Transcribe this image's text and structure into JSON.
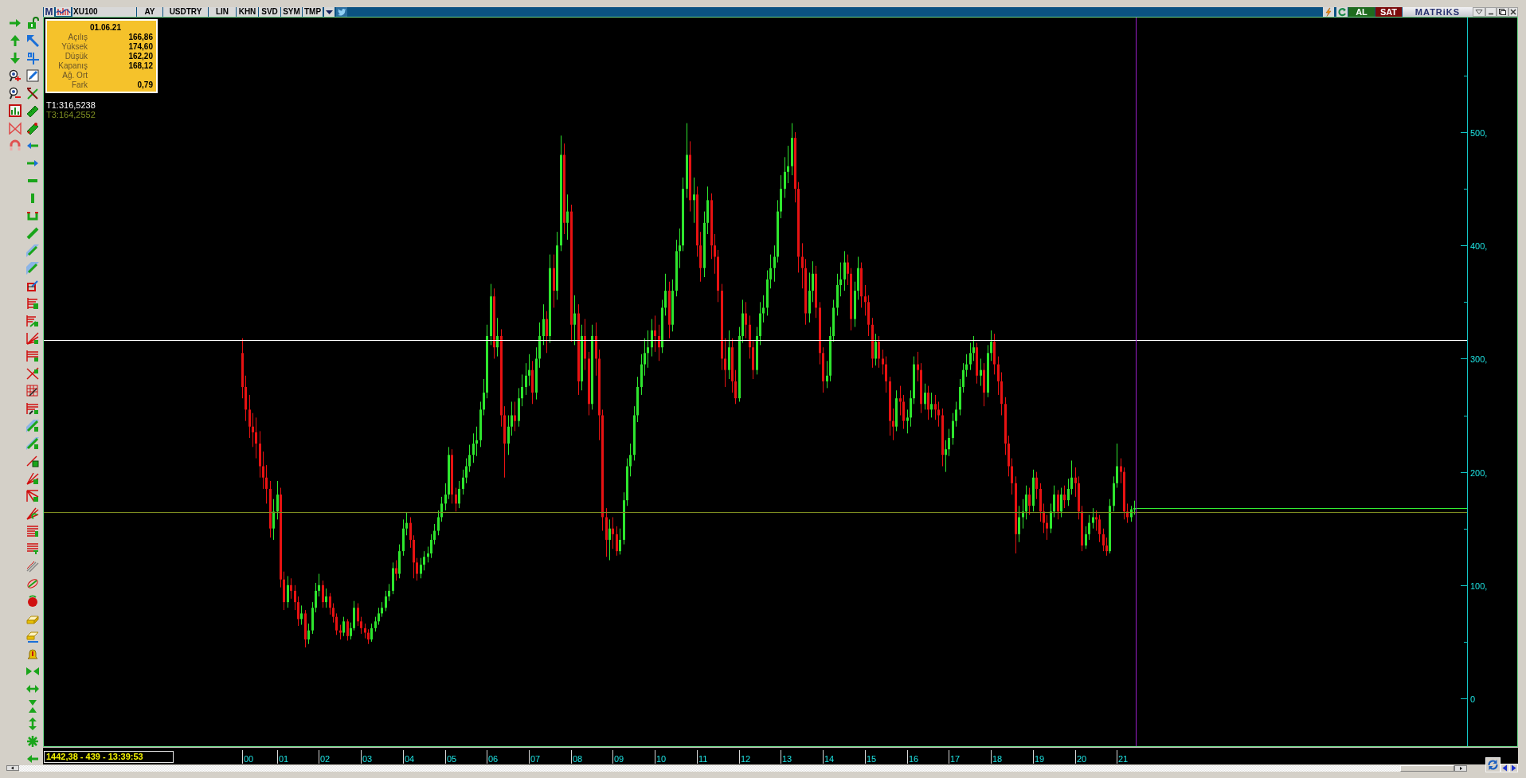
{
  "header": {
    "badge": "M",
    "symbol": "XU100",
    "buttons": [
      "AY",
      "USDTRY",
      "LIN",
      "KHN",
      "SVD",
      "SYM",
      "TMP"
    ],
    "trade_buttons": [
      {
        "label": "AL",
        "color": "#1e6b1e"
      },
      {
        "label": "SAT",
        "color": "#7c0b0b"
      }
    ],
    "logo": "MATRiKS"
  },
  "chart": {
    "info_box": {
      "date": "01.06.21",
      "rows": [
        {
          "label": "Açılış",
          "value": "166,86"
        },
        {
          "label": "Yüksek",
          "value": "174,60"
        },
        {
          "label": "Düşük",
          "value": "162,20"
        },
        {
          "label": "Kapanış",
          "value": "168,12"
        },
        {
          "label": "Ağ. Ort"
        },
        {
          "label": "Fark",
          "value": "0,79"
        }
      ]
    },
    "line_labels": [
      {
        "label": "T1:316,5238",
        "color": "#ffffff"
      },
      {
        "label": "T3:164,2552",
        "color": "#7f8f22"
      }
    ],
    "y_axis_labels": [
      "500,",
      "400,",
      "300,",
      "200,",
      "100,",
      "0"
    ],
    "x_axis_labels": [
      "00",
      "01",
      "02",
      "03",
      "04",
      "05",
      "06",
      "07",
      "08",
      "09",
      "10",
      "11",
      "12",
      "13",
      "14",
      "15",
      "16",
      "17",
      "18",
      "19",
      "20",
      "21"
    ]
  },
  "status": "1442,38 - 439 - 13:39:53"
}
